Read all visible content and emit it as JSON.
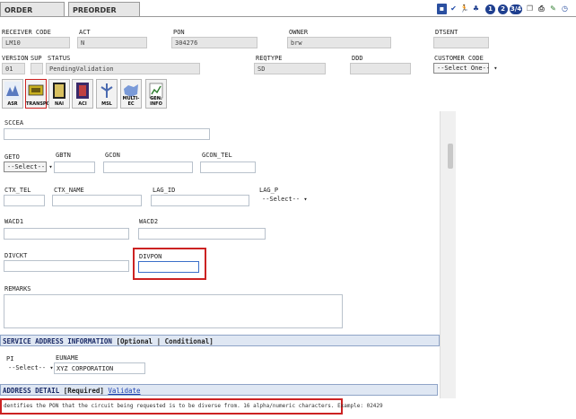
{
  "tabs": {
    "order": "ORDER",
    "preorder": "PREORDER"
  },
  "toolbar": {
    "num1": "1",
    "num2": "2",
    "num34": "3/4"
  },
  "header": {
    "receiver_code_label": "RECEIVER CODE",
    "receiver_code_value": "LM10",
    "act_label": "ACT",
    "act_value": "N",
    "pon_label": "PON",
    "pon_value": "304276",
    "owner_label": "OWNER",
    "owner_value": "brw",
    "dtsent_label": "DTSENT",
    "dtsent_value": "",
    "version_label": "VERSION",
    "version_value": "01",
    "sup_label": "SUP",
    "sup_value": "",
    "status_label": "STATUS",
    "status_value": "PendingValidation",
    "reqtype_label": "REQTYPE",
    "reqtype_value": "SD",
    "ddd_label": "DDD",
    "ddd_value": "",
    "customer_code_label": "CUSTOMER CODE",
    "customer_code_value": "--Select One--"
  },
  "icons": [
    {
      "label": "ASR"
    },
    {
      "label": "TRANSPORT"
    },
    {
      "label": "NAI"
    },
    {
      "label": "ACI"
    },
    {
      "label": "MSL"
    },
    {
      "label": "MULTI-EC"
    },
    {
      "label": "GEN. INFO"
    }
  ],
  "form": {
    "sccea_label": "SCCEA",
    "geto_label": "GETO",
    "geto_value": "--Select--",
    "gbtn_label": "GBTN",
    "gcon_label": "GCON",
    "gcon_tel_label": "GCON_TEL",
    "ctx_tel_label": "CTX_TEL",
    "ctx_name_label": "CTX_NAME",
    "lag_id_label": "LAG_ID",
    "lag_p_label": "LAG_P",
    "lag_p_value": "--Select--",
    "wacd1_label": "WACD1",
    "wacd2_label": "WACD2",
    "divckt_label": "DIVCKT",
    "divpon_label": "DIVPON",
    "remarks_label": "REMARKS"
  },
  "service_address": {
    "title": "SERVICE ADDRESS INFORMATION",
    "tags": "[Optional | Conditional]",
    "pi_label": "PI",
    "pi_value": "--Select--",
    "euname_label": "EUNAME",
    "euname_value": "XYZ CORPORATION"
  },
  "address_detail": {
    "title": "ADDRESS DETAIL",
    "required": "[Required]",
    "validate_link": "Validate"
  },
  "help_text": "dentifies the PON that the circuit being requested is to be diverse from. 16 alpha/numeric characters. Example: 02429",
  "colors": {
    "highlight": "#cc2222",
    "section_bg": "#dfe7f3",
    "link": "#1a3fb0"
  }
}
